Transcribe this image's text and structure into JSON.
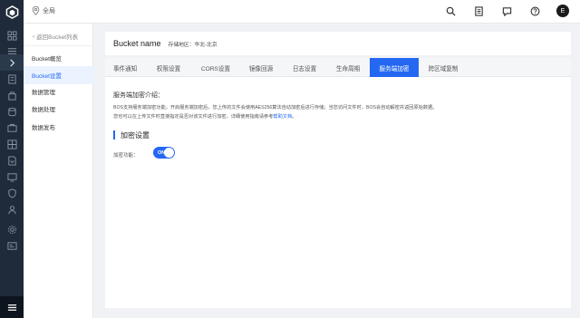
{
  "topbar": {
    "region_label": "全局"
  },
  "user": {
    "avatar_initial": "E"
  },
  "sidebar": {
    "back_label": "返回Bucket列表",
    "items": [
      {
        "label": "Bucket概览",
        "active": false
      },
      {
        "label": "Bucket设置",
        "active": true
      },
      {
        "label": "数据管理",
        "active": false
      },
      {
        "label": "数据处理",
        "active": false
      },
      {
        "label": "数据发布",
        "active": false
      }
    ]
  },
  "header": {
    "bucket_name": "Bucket name",
    "region": "存储地区：华北-北京"
  },
  "tabs": [
    {
      "label": "事件通知"
    },
    {
      "label": "权限设置"
    },
    {
      "label": "CORS设置"
    },
    {
      "label": "镜像回源"
    },
    {
      "label": "日志设置"
    },
    {
      "label": "生命周期"
    },
    {
      "label": "服务端加密",
      "active": true
    },
    {
      "label": "跨区域复制"
    }
  ],
  "intro": {
    "title": "服务端加密介绍：",
    "line1": "BOS支持服务端加密功能，开启服务端加密后，您上传的文件会使用AES256算法自动加密后进行存储；当您访问文件时，BOS会自动解密并返回原始数据。",
    "line2_prefix": "您也可以在上传文件时直接指定是否对该文件进行加密，详细使用指南请参考",
    "line2_link": "帮助文档",
    "line2_suffix": "。"
  },
  "encryption": {
    "section_title": "加密设置",
    "toggle_label": "加密功能：",
    "toggle_text": "ON",
    "enabled": true
  },
  "colors": {
    "accent": "#2468f2",
    "rail": "#1f2a3a",
    "page_bg": "#f0f2f5"
  }
}
